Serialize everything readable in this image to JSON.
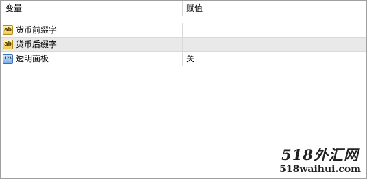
{
  "table": {
    "columns": [
      "变量",
      "赋值"
    ],
    "rows": [
      {
        "icon": "ab",
        "icon_name": "string-type-icon",
        "name": "货币前缀字",
        "value": "",
        "selected": false
      },
      {
        "icon": "ab",
        "icon_name": "string-type-icon",
        "name": "货币后缀字",
        "value": "",
        "selected": true
      },
      {
        "icon": "123",
        "icon_name": "number-type-icon",
        "name": "透明面板",
        "value": "关",
        "selected": false
      }
    ]
  },
  "watermark": {
    "logo_text": "518外汇网",
    "url": "518waihui.com"
  },
  "colors": {
    "border": "#a0a0a0",
    "grid": "#d9d9d9",
    "selected_row": "#e9e9e9",
    "string_icon": "#f0cc4c",
    "number_icon": "#7fb2e8"
  }
}
